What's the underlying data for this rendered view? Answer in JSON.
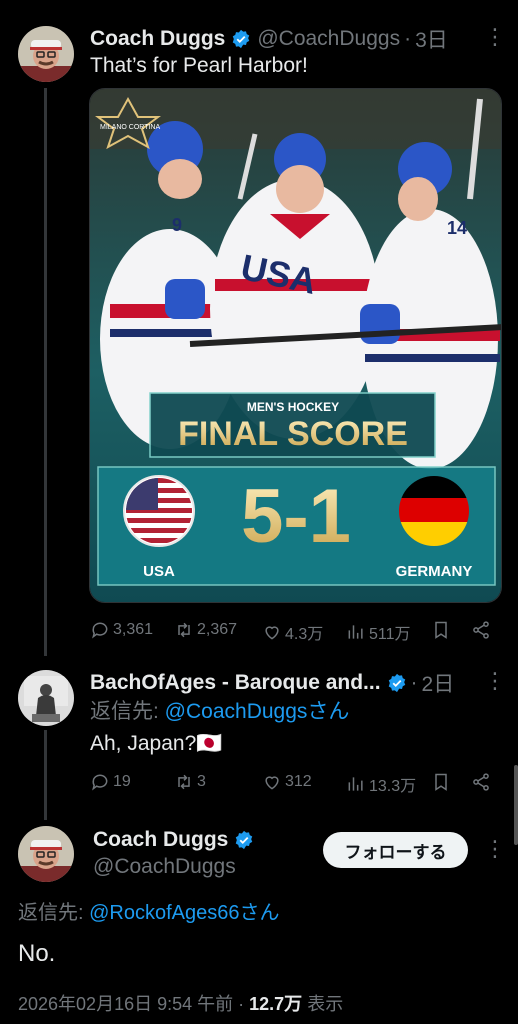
{
  "tweet1": {
    "name": "Coach Duggs",
    "handle": "@CoachDuggs",
    "time": "3日",
    "text": "That’s for Pearl Harbor!",
    "media": {
      "badge_text": "MILANO CORTINA",
      "heading_small": "MEN'S HOCKEY",
      "heading_big": "FINAL SCORE",
      "score": "5-1",
      "team_left": "USA",
      "team_right": "GERMANY",
      "jersey_text": "USA",
      "numbers": [
        "9",
        "14"
      ]
    },
    "stats": {
      "replies": "3,361",
      "retweets": "2,367",
      "likes": "4.3万",
      "views": "511万"
    }
  },
  "tweet2": {
    "name": "BachOfAges - Baroque and...",
    "time": "2日",
    "reply_to_label": "返信先: ",
    "reply_to_handle": "@CoachDuggsさん",
    "text": "Ah, Japan?🇯🇵",
    "stats": {
      "replies": "19",
      "retweets": "3",
      "likes": "312",
      "views": "13.3万"
    }
  },
  "tweet3": {
    "name": "Coach Duggs",
    "handle": "@CoachDuggs",
    "follow_label": "フォローする",
    "reply_to_label": "返信先: ",
    "reply_to_handle": "@RockofAges66さん",
    "text": "No.",
    "timestamp": "2026年02月16日 9:54 午前",
    "views_count": "12.7万",
    "views_label": "表示"
  },
  "colors": {
    "accent": "#1d9bf0",
    "muted": "#71767b",
    "background": "#000000"
  }
}
